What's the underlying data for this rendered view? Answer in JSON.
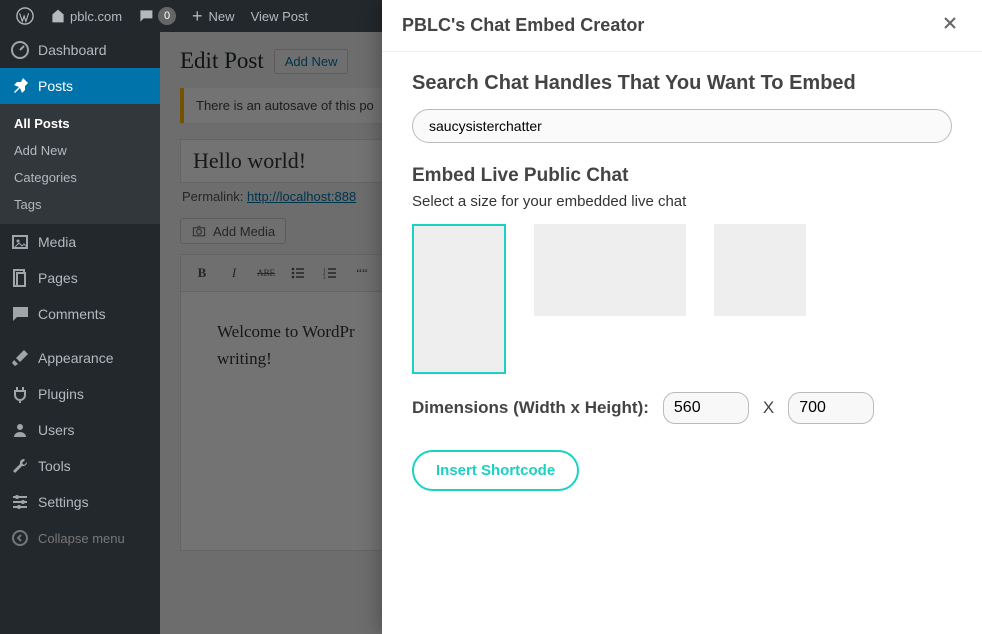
{
  "adminbar": {
    "site_name": "pblc.com",
    "comments_count": "0",
    "new_label": "New",
    "view_label": "View Post"
  },
  "sidemenu": {
    "dashboard": "Dashboard",
    "posts": "Posts",
    "posts_sub": {
      "all": "All Posts",
      "add": "Add New",
      "cats": "Categories",
      "tags": "Tags"
    },
    "media": "Media",
    "pages": "Pages",
    "comments": "Comments",
    "appearance": "Appearance",
    "plugins": "Plugins",
    "users": "Users",
    "tools": "Tools",
    "settings": "Settings",
    "collapse": "Collapse menu"
  },
  "editor": {
    "page_title": "Edit Post",
    "add_new": "Add New",
    "notice": "There is an autosave of this po",
    "title_value": "Hello world!",
    "permalink_label": "Permalink:",
    "permalink_url": "http://localhost:888",
    "add_media": "Add Media",
    "body": "Welcome to WordPr",
    "body2": "writing!",
    "toolbar": {
      "bold": "B",
      "italic": "I",
      "strike": "ABE",
      "quote": "““"
    }
  },
  "modal": {
    "title": "PBLC's Chat Embed Creator",
    "search_heading": "Search Chat Handles That You Want To Embed",
    "search_value": "saucysisterchatter",
    "embed_heading": "Embed Live Public Chat",
    "size_hint": "Select a size for your embedded live chat",
    "dim_label": "Dimensions (Width x Height):",
    "dim_sep": "X",
    "width": "560",
    "height": "700",
    "insert": "Insert Shortcode"
  }
}
